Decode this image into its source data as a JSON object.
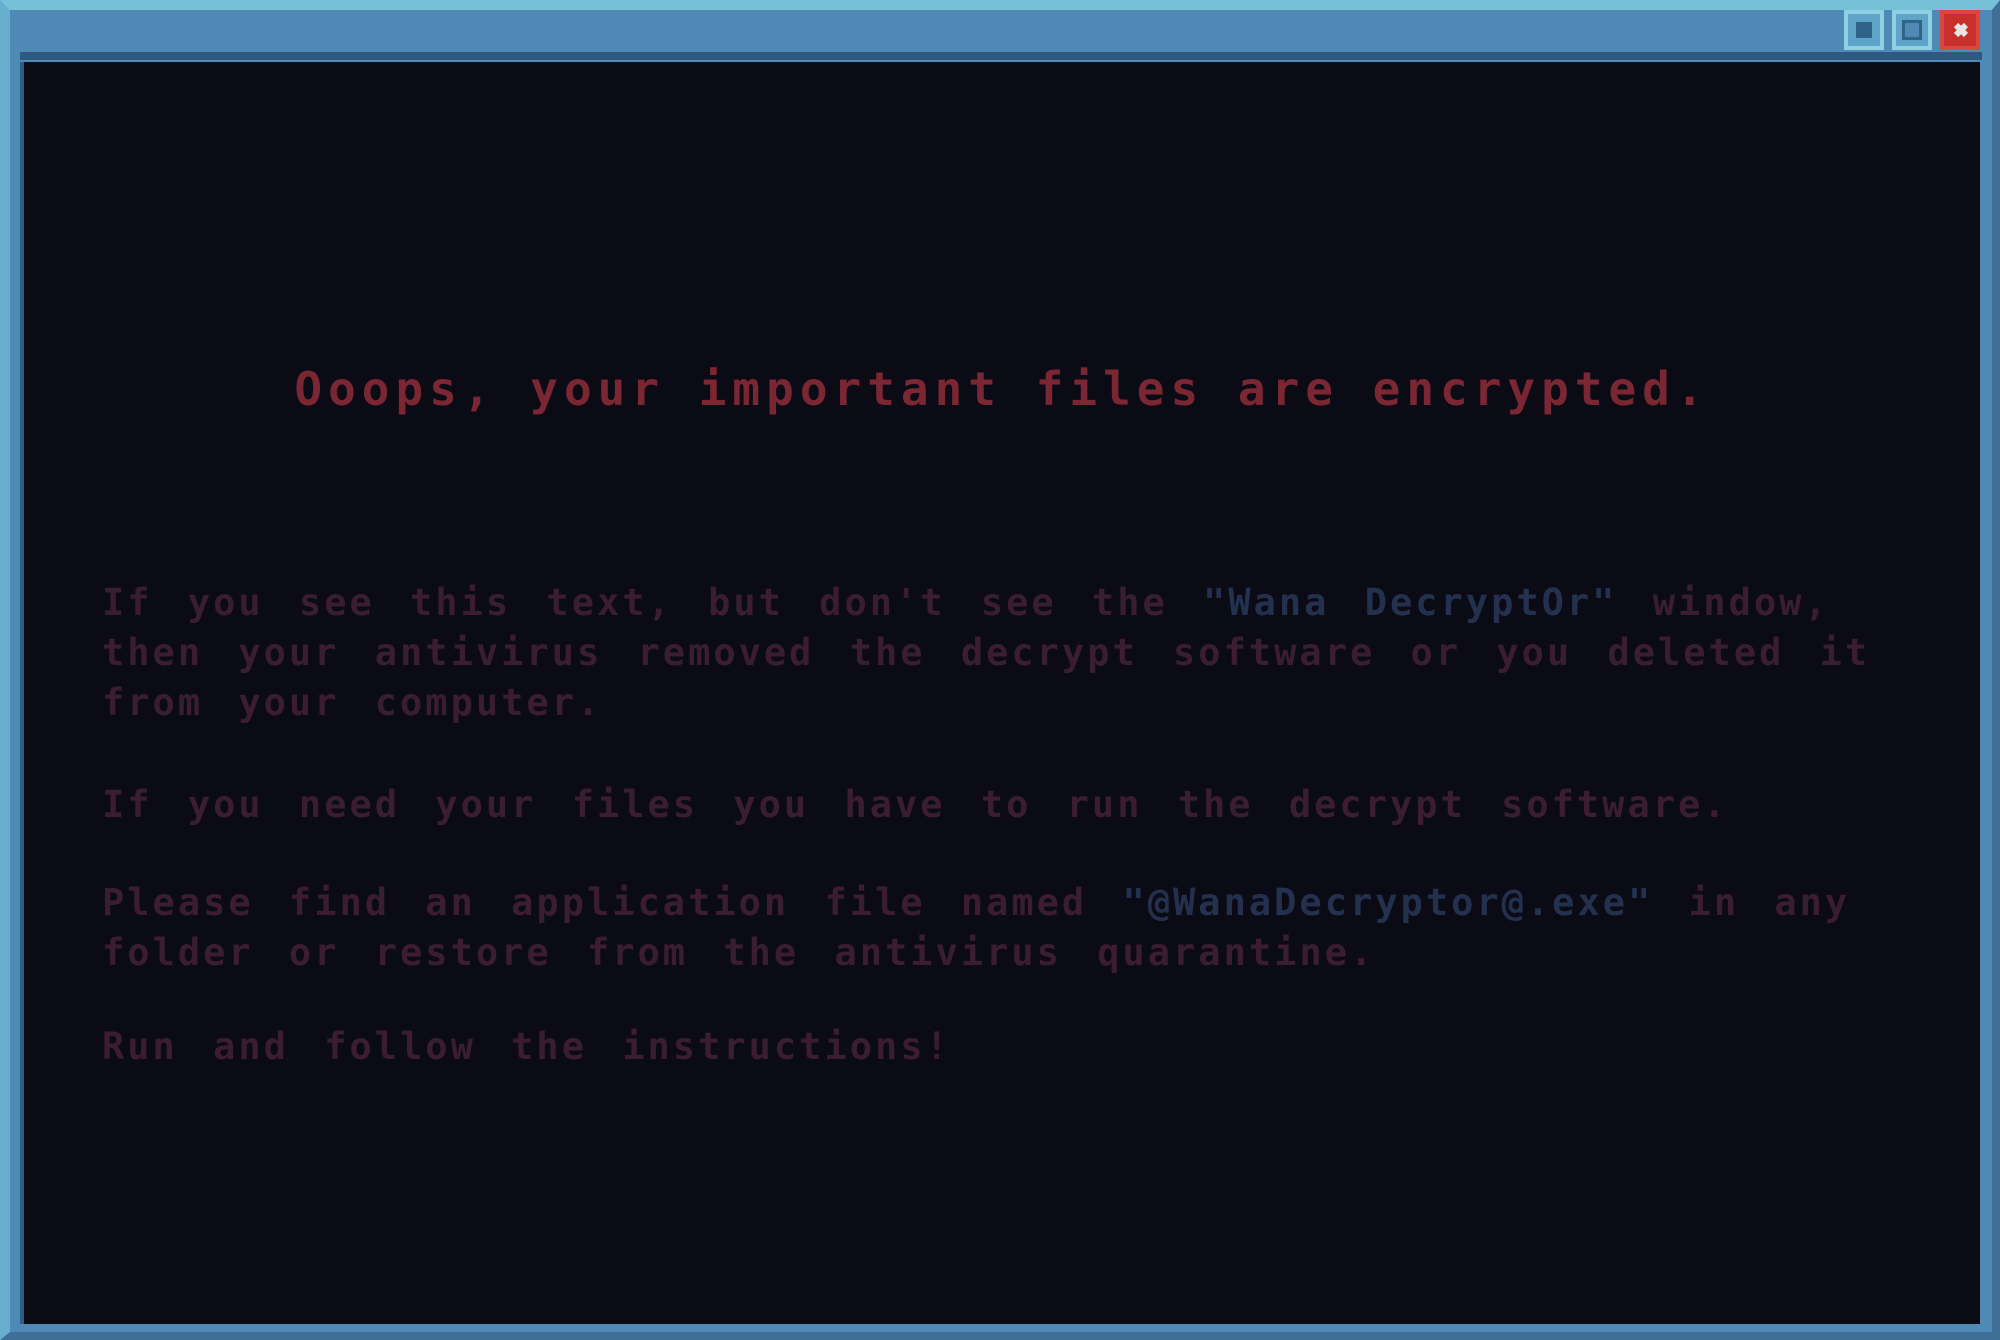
{
  "window": {
    "buttons": {
      "minimize": "minimize-icon",
      "maximize": "maximize-icon",
      "close": "close-icon"
    }
  },
  "message": {
    "headline": "Ooops, your important files are encrypted.",
    "para1_before": "If you see this text, but don't see the ",
    "para1_highlight": "\"Wana DecryptOr\"",
    "para1_after": " window, then your antivirus removed the decrypt software or you deleted it from your computer.",
    "para2": "If you need your files you have to run the decrypt software.",
    "para3_before": "Please find an application file named ",
    "para3_highlight": "\"@WanaDecryptor@.exe\"",
    "para3_after": " in any folder or restore from the antivirus quarantine.",
    "para4": "Run and follow the instructions!"
  },
  "colors": {
    "window_frame": "#4f8ab7",
    "screen_bg": "#0a0b15",
    "headline": "#7a2633",
    "body_text": "#3a1d2e",
    "highlight_text": "#23314f",
    "close_button": "#c8302c"
  }
}
